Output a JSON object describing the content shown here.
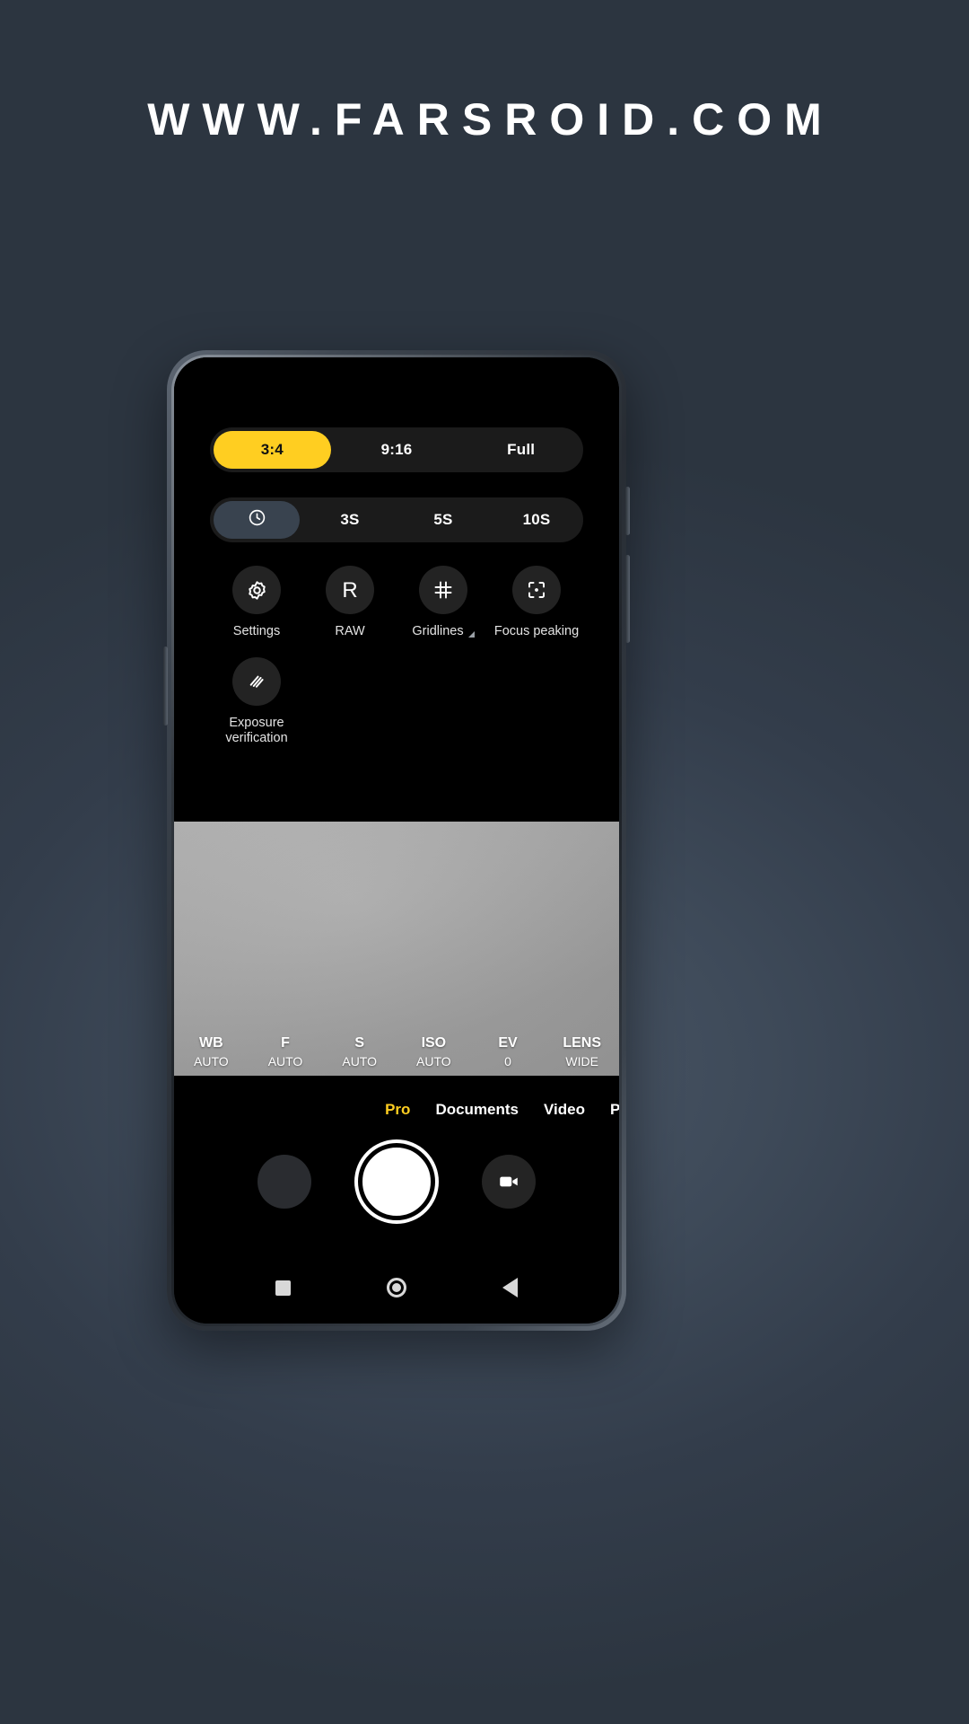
{
  "watermark": {
    "text": "WWW.FARSROID.COM"
  },
  "colors": {
    "accent_yellow": "#FFCE21",
    "panel_black": "#000000",
    "segment_track": "#1B1B1B",
    "segment_slate": "#39434F",
    "toggle_circle": "#232323",
    "backdrop": "#3E4A59"
  },
  "options_panel": {
    "aspect_ratio": {
      "name": "aspect-ratio-selector",
      "selected": "3:4",
      "items": [
        {
          "label": "3:4",
          "state": "active"
        },
        {
          "label": "9:16",
          "state": "inactive"
        },
        {
          "label": "Full",
          "state": "inactive"
        }
      ]
    },
    "timer": {
      "name": "timer-selector",
      "selected": "off",
      "items": [
        {
          "label": "",
          "icon": "clock-icon",
          "state": "active"
        },
        {
          "label": "3S",
          "state": "inactive"
        },
        {
          "label": "5S",
          "state": "inactive"
        },
        {
          "label": "10S",
          "state": "inactive"
        }
      ]
    },
    "toggles": [
      {
        "label": "Settings",
        "icon": "gear-icon",
        "has_corner_arrow": false
      },
      {
        "label": "RAW",
        "icon": "raw-letter-icon",
        "has_corner_arrow": false
      },
      {
        "label": "Gridlines",
        "icon": "grid-icon",
        "has_corner_arrow": true
      },
      {
        "label": "Focus peaking",
        "icon": "focus-frame-icon",
        "has_corner_arrow": false
      },
      {
        "label": "Exposure verification",
        "icon": "zebra-stripes-icon",
        "has_corner_arrow": false
      }
    ]
  },
  "pro_controls": [
    {
      "key": "WB",
      "value": "AUTO"
    },
    {
      "key": "F",
      "value": "AUTO"
    },
    {
      "key": "S",
      "value": "AUTO"
    },
    {
      "key": "ISO",
      "value": "AUTO"
    },
    {
      "key": "EV",
      "value": "0"
    },
    {
      "key": "LENS",
      "value": "WIDE"
    }
  ],
  "mode_tabs": [
    {
      "label": "Pro",
      "state": "active"
    },
    {
      "label": "Documents",
      "state": "inactive"
    },
    {
      "label": "Video",
      "state": "inactive"
    },
    {
      "label": "P",
      "state": "inactive"
    }
  ],
  "shutter_row": {
    "gallery_thumb": "gallery-thumbnail",
    "shutter": "shutter-button",
    "video": "video-record-button"
  },
  "nav_bar": {
    "recents": "recents-square-icon",
    "home": "home-circle-icon",
    "back": "back-triangle-icon"
  }
}
